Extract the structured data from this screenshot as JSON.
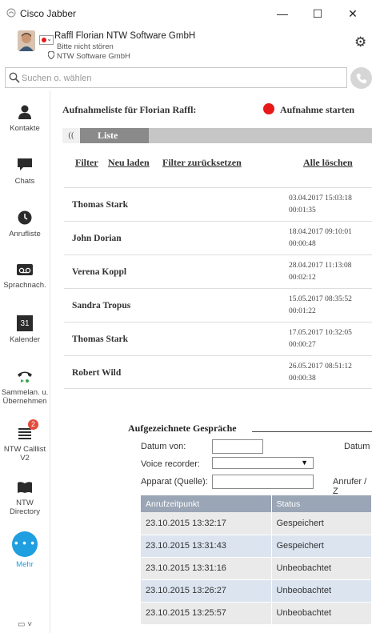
{
  "window": {
    "title": "Cisco Jabber",
    "minimize": "—",
    "maximize": "☐",
    "close": "✕"
  },
  "user": {
    "name": "Raffl Florian NTW Software GmbH",
    "status": "Bitte nicht stören",
    "location": "NTW Software GmbH",
    "status_color": "#e41a1a"
  },
  "search": {
    "placeholder": "Suchen o. wählen"
  },
  "nav": {
    "items": [
      {
        "label": "Kontakte",
        "icon": "contacts-icon"
      },
      {
        "label": "Chats",
        "icon": "chat-icon"
      },
      {
        "label": "Anrufliste",
        "icon": "clock-icon"
      },
      {
        "label": "Sprachnach.",
        "icon": "voicemail-icon"
      },
      {
        "label": "Kalender",
        "icon": "calendar-icon",
        "day": "31"
      },
      {
        "label": "Sammelan. u. Übernehmen",
        "icon": "call-pickup-icon"
      },
      {
        "label": "NTW Calllist V2",
        "icon": "list-icon",
        "badge": "2"
      },
      {
        "label": "NTW Directory",
        "icon": "book-icon"
      },
      {
        "label": "Mehr",
        "icon": "more-icon",
        "dots": "• • •"
      }
    ],
    "bottom": "▭ ˅"
  },
  "recordings": {
    "title": "Aufnahmeliste für Florian Raffl:",
    "start_label": "Aufnahme starten",
    "collapse": "((",
    "tab_label": "Liste",
    "filter": "Filter",
    "reload": "Neu laden",
    "reset_filter": "Filter zurücksetzen",
    "delete_all": "Alle löschen",
    "rows": [
      {
        "name": "Thomas Stark",
        "datetime": "03.04.2017  15:03:18",
        "duration": "00:01:35"
      },
      {
        "name": "John Dorian",
        "datetime": "18.04.2017  09:10:01",
        "duration": "00:00:48"
      },
      {
        "name": "Verena Koppl",
        "datetime": "28.04.2017  11:13:08",
        "duration": "00:02:12"
      },
      {
        "name": "Sandra Tropus",
        "datetime": "15.05.2017  08:35:52",
        "duration": "00:01:22"
      },
      {
        "name": "Thomas Stark",
        "datetime": "17.05.2017  10:32:05",
        "duration": "00:00:27"
      },
      {
        "name": "Robert Wild",
        "datetime": "26.05.2017  08:51:12",
        "duration": "00:00:38"
      }
    ]
  },
  "panel": {
    "title": "Aufgezeichnete Gespräche",
    "date_from_label": "Datum von:",
    "date_to_label": "Datum",
    "voice_recorder_label": "Voice recorder:",
    "device_label": "Apparat (Quelle):",
    "caller_label": "Anrufer / Z",
    "select_arrow": "▼",
    "columns": [
      "Anrufzeitpunkt",
      "Status"
    ],
    "rows": [
      [
        "23.10.2015 13:32:17",
        "Gespeichert"
      ],
      [
        "23.10.2015 13:31:43",
        "Gespeichert"
      ],
      [
        "23.10.2015 13:31:16",
        "Unbeobachtet"
      ],
      [
        "23.10.2015 13:26:27",
        "Unbeobachtet"
      ],
      [
        "23.10.2015 13:25:57",
        "Unbeobachtet"
      ]
    ]
  }
}
